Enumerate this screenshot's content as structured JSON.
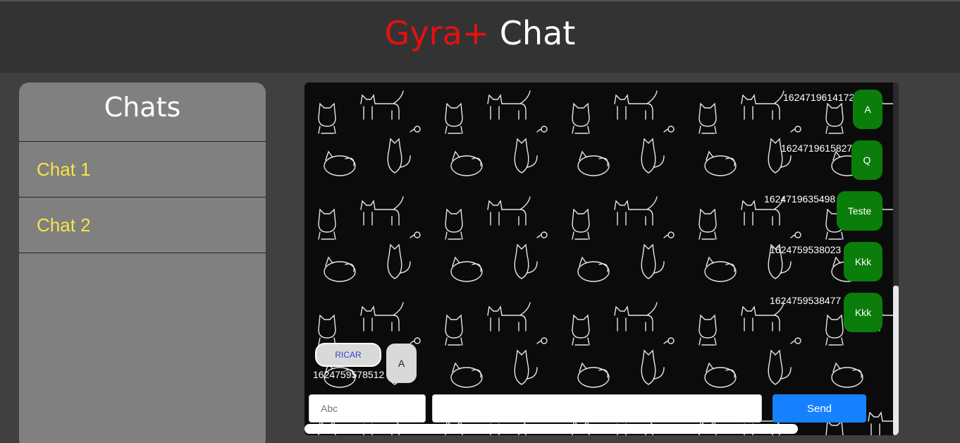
{
  "header": {
    "brand": "Gyra+",
    "title_rest": " Chat"
  },
  "sidebar": {
    "title": "Chats",
    "items": [
      {
        "label": "Chat 1"
      },
      {
        "label": "Chat 2"
      }
    ]
  },
  "chat": {
    "outgoing": [
      {
        "timestamp": "1624719614172",
        "text": "A"
      },
      {
        "timestamp": "1624719615827",
        "text": "Q"
      },
      {
        "timestamp": "1624719635498",
        "text": "Teste"
      },
      {
        "timestamp": "1624759538023",
        "text": "Kkk"
      },
      {
        "timestamp": "1624759538477",
        "text": "Kkk"
      }
    ],
    "incoming": [
      {
        "sender": "RICAR",
        "timestamp": "1624759578512",
        "text": "A"
      }
    ]
  },
  "composer": {
    "name_placeholder": "Abc",
    "message_value": "",
    "send_label": "Send"
  },
  "colors": {
    "brand": "#e80f0f",
    "outgoing_bubble": "#0a7d0a",
    "send_button": "#1680ff",
    "chat_link": "#f5e642"
  }
}
